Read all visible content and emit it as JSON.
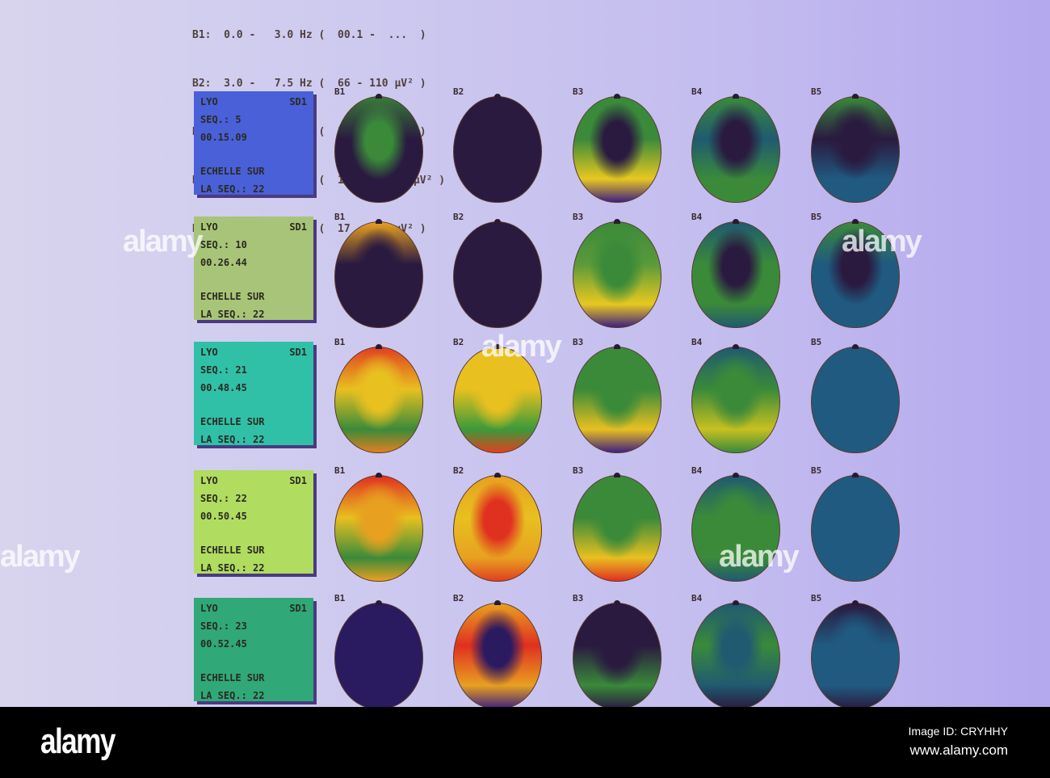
{
  "legend": [
    "B1:  0.0 -   3.0 Hz (  00.1 -  ...  )",
    "B2:  3.0 -   7.5 Hz (  66 - 110 µV² )",
    "B3:  7.5 -  13.5 Hz (  54 - 116 µV² )",
    "B4: 13.5 -  18.0 Hz (  19.2 - 98.8 µV² )",
    "B5: 18.0 -  30.0 Hz (  17 - 194 µV² )"
  ],
  "bands": [
    "B1",
    "B2",
    "B3",
    "B4",
    "B5"
  ],
  "rows": [
    {
      "site": "LYO",
      "id": "SD1",
      "seq": "SEQ.: 5",
      "time": "00.15.09",
      "scale1": "ECHELLE SUR",
      "scale2": "LA SEQ.: 22",
      "bg": "#4a60d8",
      "heads": [
        [
          "#3a7a3a",
          "#2a1a40",
          "#2a1a40",
          "#2a1a40",
          "#3a8a3a"
        ],
        [
          "#2a1a40",
          "#2a1a40",
          "#2a1a40",
          "#2a1a40",
          "#2a1a40"
        ],
        [
          "#3a8a3a",
          "#3a8a3a",
          "#e8c820",
          "#402080",
          "#2a1a40"
        ],
        [
          "#3a8a3a",
          "#205a70",
          "#3a8a3a",
          "#3a8a3a",
          "#2a1a40"
        ],
        [
          "#3a8a3a",
          "#2a1a40",
          "#205a80",
          "#205a80",
          "#2a1a40"
        ]
      ]
    },
    {
      "site": "LYO",
      "id": "SD1",
      "seq": "SEQ.: 10",
      "time": "00.26.44",
      "scale1": "ECHELLE SUR",
      "scale2": "LA SEQ.: 22",
      "bg": "#a8c478",
      "heads": [
        [
          "#e8a020",
          "#2a1a40",
          "#2a1a40",
          "#2a1a40",
          "#2a1a40"
        ],
        [
          "#2a1a40",
          "#2a1a40",
          "#2a1a40",
          "#2a1a40",
          "#2a1a40"
        ],
        [
          "#3a8a3a",
          "#5a9a3a",
          "#e8c820",
          "#402080",
          "#3a8a3a"
        ],
        [
          "#205a70",
          "#3a8a3a",
          "#3a8a3a",
          "#205a70",
          "#2a1a40"
        ],
        [
          "#3a8a3a",
          "#205a80",
          "#205a80",
          "#205a80",
          "#2a1a40"
        ]
      ]
    },
    {
      "site": "LYO",
      "id": "SD1",
      "seq": "SEQ.: 21",
      "time": "00.48.45",
      "scale1": "ECHELLE SUR",
      "scale2": "LA SEQ.: 22",
      "bg": "#30c0a8",
      "heads": [
        [
          "#e04020",
          "#e8c020",
          "#3a8a3a",
          "#e08020",
          "#e8c020"
        ],
        [
          "#e8c020",
          "#e8c020",
          "#3a9a3a",
          "#e04020",
          "#e8c020"
        ],
        [
          "#3a8a3a",
          "#3a8a3a",
          "#e8c020",
          "#402080",
          "#3a8a3a"
        ],
        [
          "#205a70",
          "#3a8a3a",
          "#c8c020",
          "#3a8a3a",
          "#3a8a3a"
        ],
        [
          "#205a80",
          "#205a80",
          "#205a80",
          "#205a80",
          "#205a80"
        ]
      ]
    },
    {
      "site": "LYO",
      "id": "SD1",
      "seq": "SEQ.: 22",
      "time": "00.50.45",
      "scale1": "ECHELLE SUR",
      "scale2": "LA SEQ.: 22",
      "bg": "#b0dc60",
      "heads": [
        [
          "#e03020",
          "#e8c020",
          "#3a8a3a",
          "#e8a020",
          "#e8a020"
        ],
        [
          "#e8a020",
          "#e8c020",
          "#e8a020",
          "#e04020",
          "#e03020"
        ],
        [
          "#3a8a3a",
          "#3a8a3a",
          "#e8c020",
          "#e03020",
          "#3a8a3a"
        ],
        [
          "#205a70",
          "#3a8a3a",
          "#3a8a3a",
          "#205a70",
          "#3a8a3a"
        ],
        [
          "#205a80",
          "#205a80",
          "#205a80",
          "#205a80",
          "#205a80"
        ]
      ]
    },
    {
      "site": "LYO",
      "id": "SD1",
      "seq": "SEQ.: 23",
      "time": "00.52.45",
      "scale1": "ECHELLE SUR",
      "scale2": "LA SEQ.: 22",
      "bg": "#30a878",
      "heads": [
        [
          "#2a1a60",
          "#2a1a60",
          "#2a1a60",
          "#2a1a60",
          "#2a1a60"
        ],
        [
          "#e8a020",
          "#e03020",
          "#e8a020",
          "#402080",
          "#2a1a60"
        ],
        [
          "#2a1a40",
          "#2a1a40",
          "#3a8a3a",
          "#2a1a40",
          "#2a1a40"
        ],
        [
          "#205a70",
          "#3a8a3a",
          "#205a70",
          "#2a1a40",
          "#205a70"
        ],
        [
          "#2a1a40",
          "#205a80",
          "#205a80",
          "#2a1a40",
          "#205a80"
        ]
      ]
    }
  ],
  "watermark": "alamy",
  "footer": {
    "logo": "alamy",
    "image_id": "Image ID: CRYHHY",
    "site": "www.alamy.com"
  }
}
